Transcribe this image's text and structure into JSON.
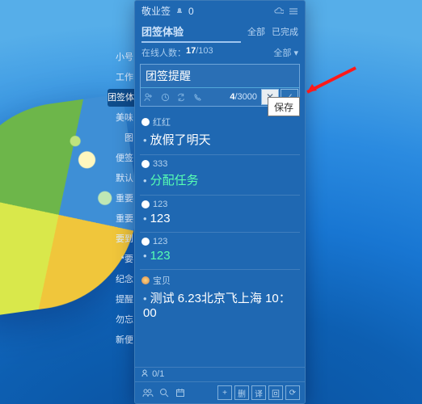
{
  "app": {
    "title": "敬业签",
    "count": "0"
  },
  "header": {
    "team_name": "团签体验",
    "filter_all": "全部",
    "filter_done": "已完成",
    "online_label": "在线人数：",
    "online_current": "17",
    "online_total": "/103",
    "filter_all2": "全部 ▾"
  },
  "compose": {
    "text": "团签提醒",
    "counter_current": "4",
    "counter_total": "/3000"
  },
  "tooltip": "保存",
  "side_tabs": [
    "小号",
    "工作",
    "团签体验",
    "美味",
    "图",
    "便签",
    "默认",
    "重要",
    "重要",
    "要到",
    "*要",
    "纪念",
    "提醒",
    "勿忘",
    "新便"
  ],
  "side_active_index": 2,
  "notes": [
    {
      "author": "红红",
      "avatar": "white",
      "lock": true,
      "text": "放假了明天",
      "green": false
    },
    {
      "author": "333",
      "avatar": "white",
      "lock": true,
      "text": "分配任务",
      "green": true
    },
    {
      "author": "123",
      "avatar": "white",
      "lock": true,
      "text": "123",
      "green": false
    },
    {
      "author": "123",
      "avatar": "white",
      "lock": true,
      "text": "123",
      "green": true
    },
    {
      "author": "宝贝",
      "avatar": "color",
      "lock": true,
      "text": "测试 6.23北京飞上海 10：00",
      "green": false
    }
  ],
  "assign": {
    "label": "0/1"
  },
  "bottom": {
    "b1": "删",
    "b2": "译",
    "b3": "回",
    "b4": "⟳"
  }
}
